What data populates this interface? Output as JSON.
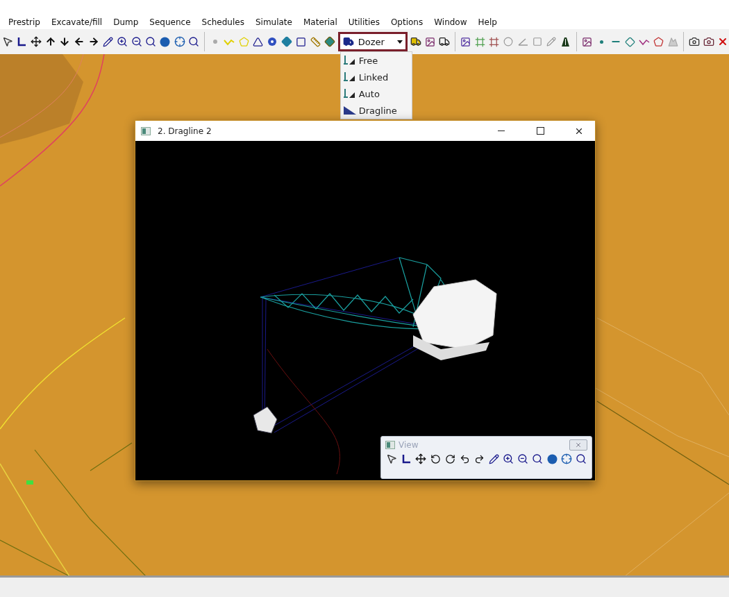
{
  "menu": [
    "Prestrip",
    "Excavate/fill",
    "Dump",
    "Sequence",
    "Schedules",
    "Simulate",
    "Material",
    "Utilities",
    "Options",
    "Window",
    "Help"
  ],
  "mode_select": {
    "value": "Dozer",
    "expanded": true
  },
  "mode_options": [
    {
      "label": "Free"
    },
    {
      "label": "Linked"
    },
    {
      "label": "Auto"
    },
    {
      "label": "Dragline"
    }
  ],
  "viewport_window": {
    "title": "2. Dragline 2"
  },
  "view_toolbar": {
    "title": "View"
  }
}
